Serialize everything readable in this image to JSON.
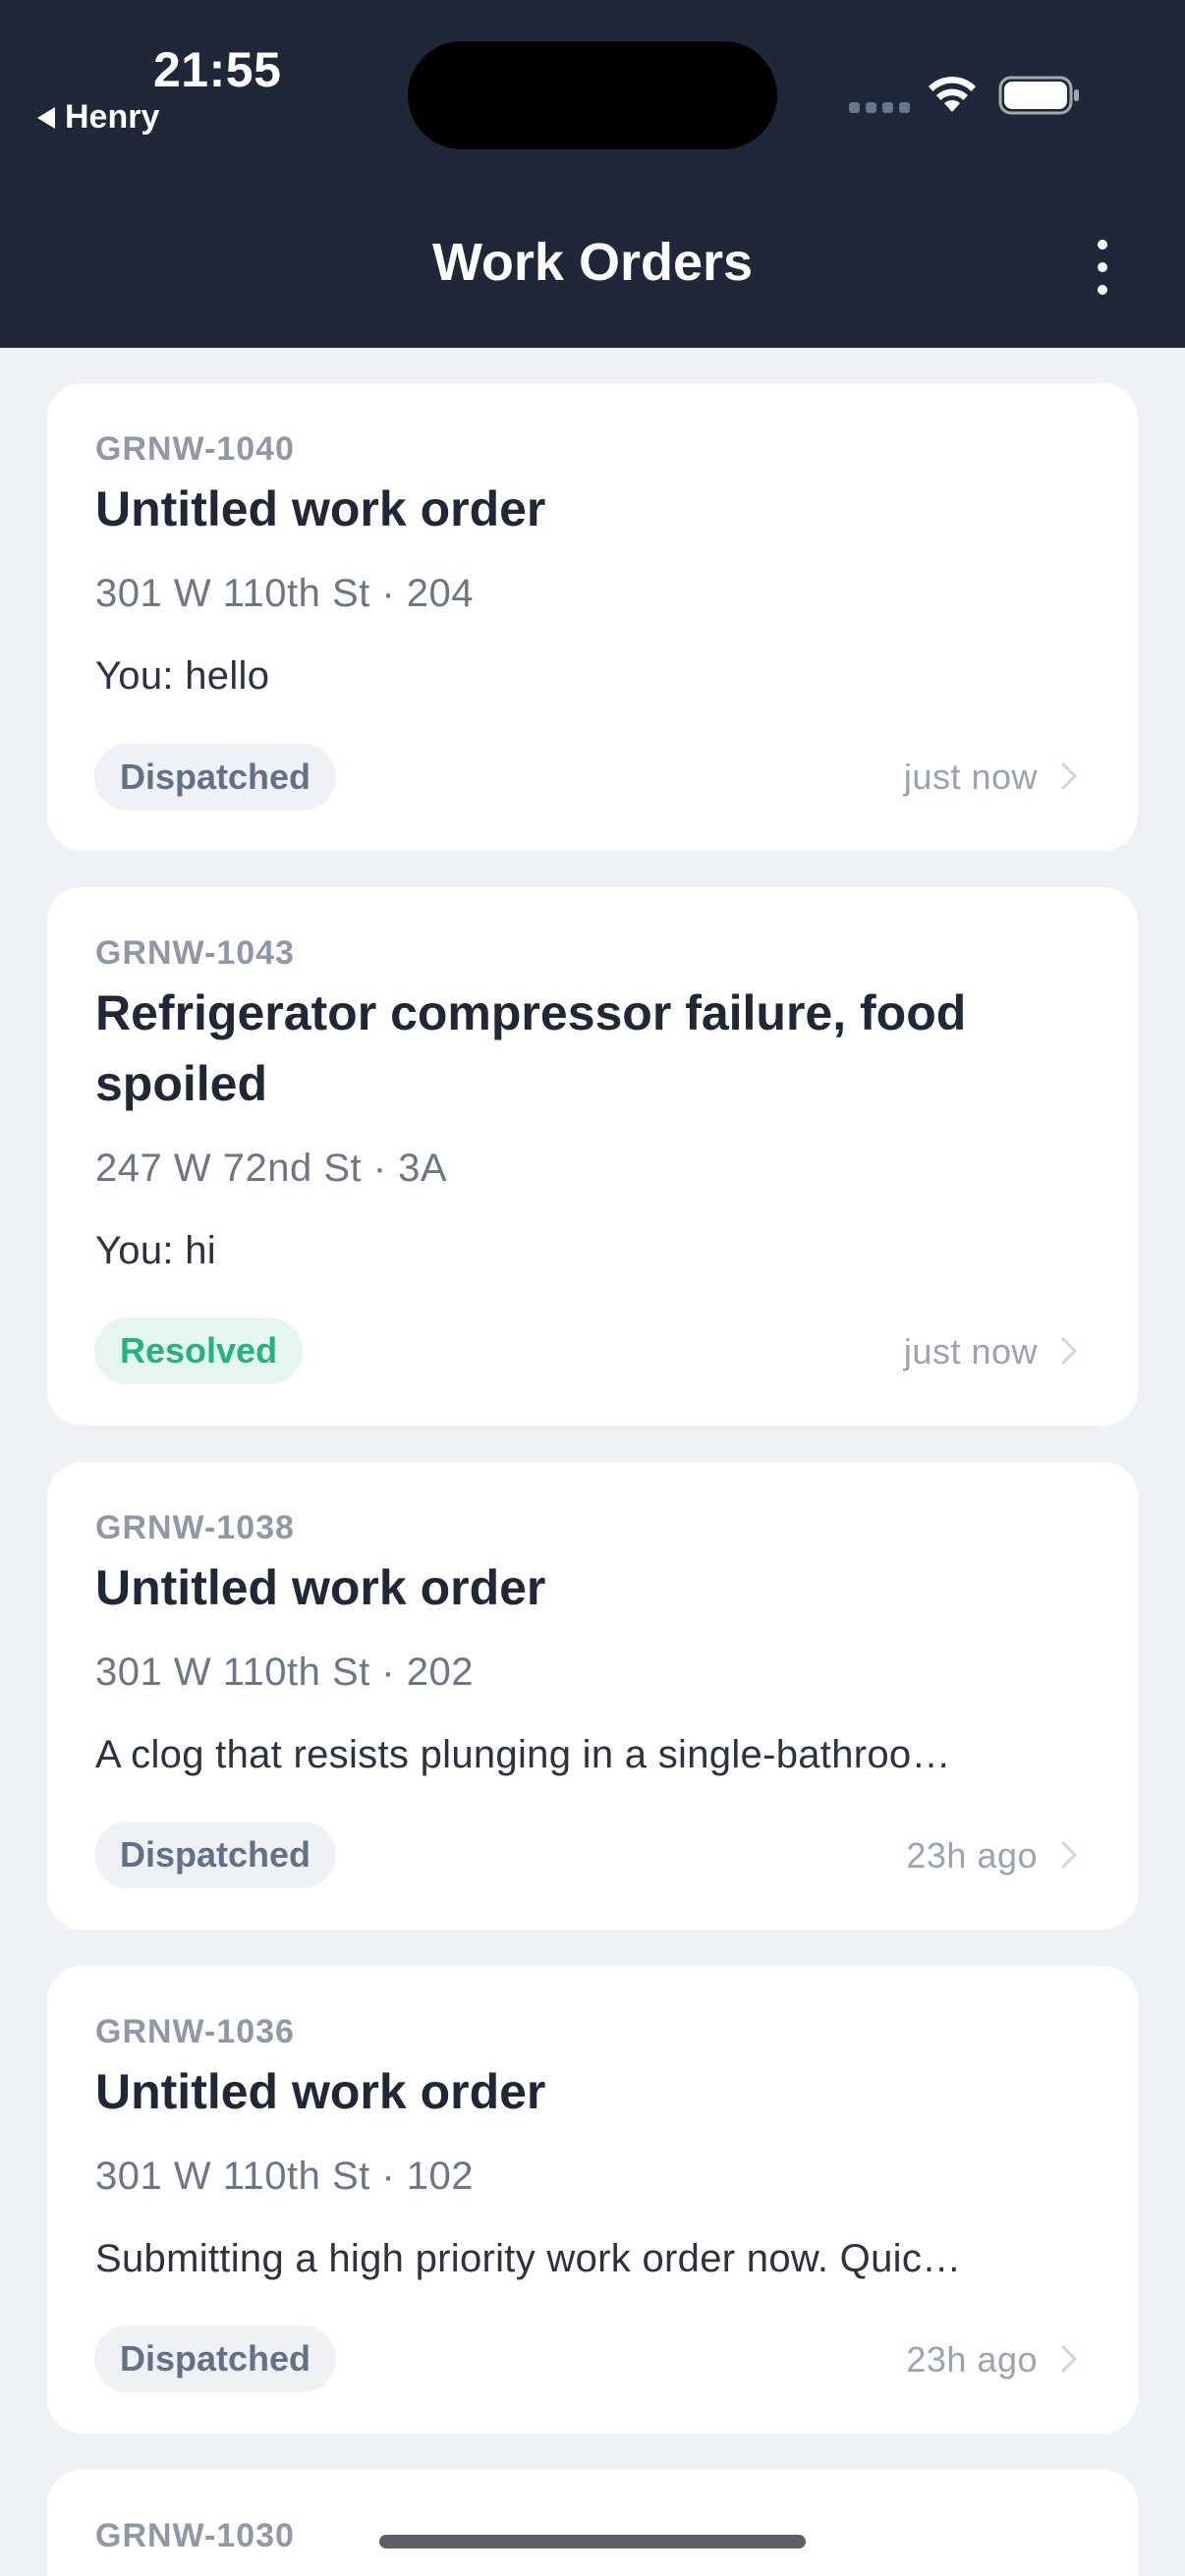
{
  "status": {
    "time": "21:55",
    "back_app": "Henry"
  },
  "header": {
    "title": "Work Orders"
  },
  "work_orders": [
    {
      "id": "GRNW-1040",
      "title": "Untitled work order",
      "address": "301 W 110th St · 204",
      "last_message": "You: hello",
      "status": "Dispatched",
      "time": "just now"
    },
    {
      "id": "GRNW-1043",
      "title": "Refrigerator compressor failure, food spoiled",
      "address": "247 W 72nd St · 3A",
      "last_message": "You: hi",
      "status": "Resolved",
      "time": "just now"
    },
    {
      "id": "GRNW-1038",
      "title": "Untitled work order",
      "address": "301 W 110th St · 202",
      "last_message": "A clog that resists plunging in a single-bathroo…",
      "status": "Dispatched",
      "time": "23h ago"
    },
    {
      "id": "GRNW-1036",
      "title": "Untitled work order",
      "address": "301 W 110th St · 102",
      "last_message": "Submitting a high priority work order now. Quic…",
      "status": "Dispatched",
      "time": "23h ago"
    },
    {
      "id": "GRNW-1030"
    }
  ],
  "colors": {
    "header_bg": "#1f2739",
    "dispatched": "#647087",
    "resolved": "#21b57a"
  }
}
